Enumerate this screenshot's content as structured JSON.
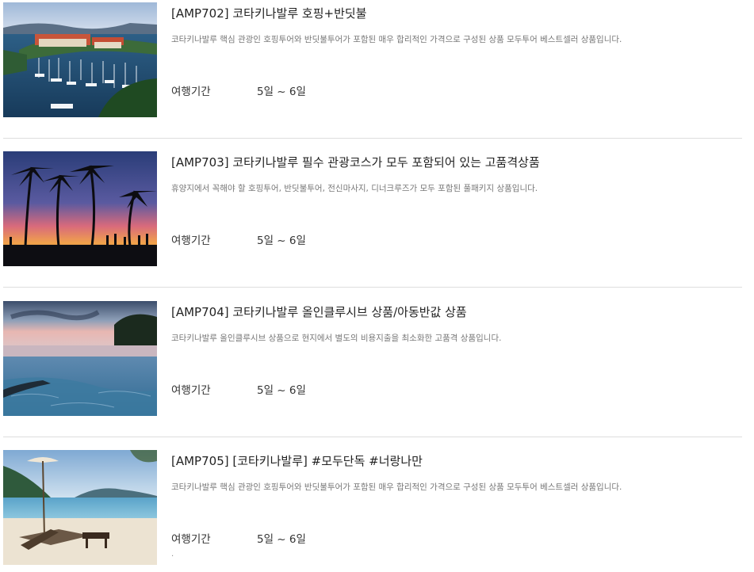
{
  "products": [
    {
      "title": "[AMP702] 코타키나발루 호핑+반딧불",
      "description": "코타키나발루 핵심 관광인 호핑투어와 반딧불투어가 포함된 매우 합리적인 가격으로 구성된 상품 모두투어 베스트셀러 상품입니다.",
      "period_label": "여행기간",
      "period_value": "5일 ~ 6일",
      "image_icon": "marina-resort-photo"
    },
    {
      "title": "[AMP703] 코타키나발루 필수 관광코스가 모두 포함되어 있는 고품격상품",
      "description": "휴양지에서 꼭해야 할 호핑투어, 반딧불투어, 전신마사지, 디너크루즈가 모두 포함된 풀패키지 상품입니다.",
      "period_label": "여행기간",
      "period_value": "5일 ~ 6일",
      "image_icon": "palm-sunset-photo"
    },
    {
      "title": "[AMP704] 코타키나발루 올인클루시브 상품/아동반값 상품",
      "description": "코타키나발루 올인클루시브 상품으로 현지에서 별도의 비용지출을 최소화한 고품격 상품입니다.",
      "period_label": "여행기간",
      "period_value": "5일 ~ 6일",
      "image_icon": "infinity-pool-photo"
    },
    {
      "title": "[AMP705] [코타키나발루] #모두단독 #너랑나만",
      "description": "코타키나발루 핵심 관광인 호핑투어와 반딧불투어가 포함된 매우 합리적인 가격으로 구성된 상품 모두투어 베스트셀러 상품입니다.",
      "period_label": "여행기간",
      "period_value": "5일 ~ 6일",
      "image_icon": "beach-lounger-photo"
    }
  ],
  "footer_mark": "."
}
